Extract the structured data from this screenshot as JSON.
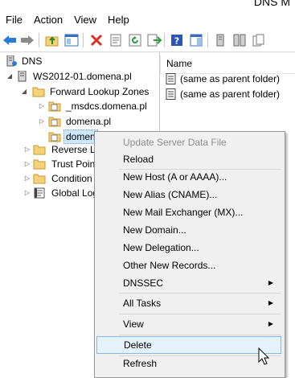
{
  "window": {
    "title": "DNS M"
  },
  "menubar": {
    "items": [
      "File",
      "Action",
      "View",
      "Help"
    ]
  },
  "tree": {
    "nodes": [
      {
        "label": "DNS"
      },
      {
        "label": "WS2012-01.domena.pl"
      },
      {
        "label": "Forward Lookup Zones"
      },
      {
        "label": "_msdcs.domena.pl"
      },
      {
        "label": "domena.pl"
      },
      {
        "label": "domen"
      },
      {
        "label": "Reverse Lo"
      },
      {
        "label": "Trust Poin"
      },
      {
        "label": "Condition"
      },
      {
        "label": "Global Log"
      }
    ]
  },
  "list": {
    "column_name": "Name",
    "rows": [
      {
        "label": "(same as parent folder)"
      },
      {
        "label": "(same as parent folder)"
      }
    ]
  },
  "context_menu": {
    "items": [
      {
        "label": "Update Server Data File"
      },
      {
        "label": "Reload"
      },
      {
        "label": "New Host (A or AAAA)..."
      },
      {
        "label": "New Alias (CNAME)..."
      },
      {
        "label": "New Mail Exchanger (MX)..."
      },
      {
        "label": "New Domain..."
      },
      {
        "label": "New Delegation..."
      },
      {
        "label": "Other New Records..."
      },
      {
        "label": "DNSSEC"
      },
      {
        "label": "All Tasks"
      },
      {
        "label": "View"
      },
      {
        "label": "Delete"
      },
      {
        "label": "Refresh"
      }
    ]
  },
  "icons": {
    "toolbar": [
      "back-arrow-icon",
      "forward-arrow-icon",
      "up-folder-icon",
      "show-hide-tree-icon",
      "delete-icon",
      "properties-icon",
      "refresh-icon",
      "export-list-icon",
      "help-icon",
      "action-pane-icon",
      "server-icon",
      "server-list-icon",
      "copy-icon"
    ],
    "submenu_arrow": "▶",
    "expanded": "◢",
    "collapsed": "▷"
  },
  "colors": {
    "accent_blue": "#1f6fc5",
    "folder_yellow": "#f4d27a",
    "delete_red": "#d93025",
    "selection": "#cce8ff",
    "menu_hover": "#e5f1fb"
  }
}
